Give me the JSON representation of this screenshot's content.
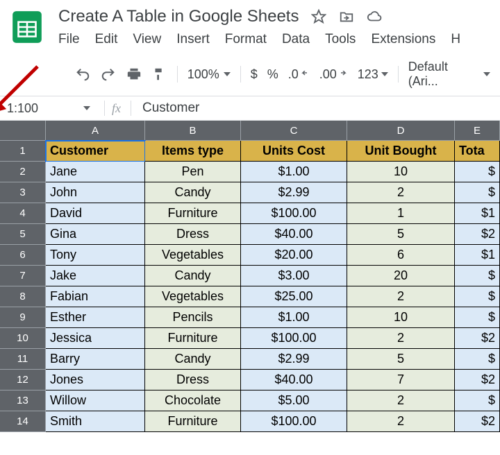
{
  "doc": {
    "title": "Create A Table in Google Sheets"
  },
  "menubar": [
    "File",
    "Edit",
    "View",
    "Insert",
    "Format",
    "Data",
    "Tools",
    "Extensions",
    "H"
  ],
  "toolbar": {
    "zoom": "100%",
    "currency": "$",
    "percent": "%",
    "dec_dec": ".0",
    "inc_dec": ".00",
    "more_fmt": "123",
    "font": "Default (Ari..."
  },
  "namebox": "1:100",
  "fx_label": "fx",
  "formula": "Customer",
  "columns": [
    "A",
    "B",
    "C",
    "D",
    "E"
  ],
  "rows": [
    "1",
    "2",
    "3",
    "4",
    "5",
    "6",
    "7",
    "8",
    "9",
    "10",
    "11",
    "12",
    "13",
    "14"
  ],
  "headers": {
    "A": "Customer",
    "B": "Items type",
    "C": "Units Cost",
    "D": "Unit Bought",
    "E": "Tota"
  },
  "data": [
    {
      "name": "Jane",
      "type": "Pen",
      "cost": "$1.00",
      "units": "10",
      "total": "$"
    },
    {
      "name": "John",
      "type": "Candy",
      "cost": "$2.99",
      "units": "2",
      "total": "$"
    },
    {
      "name": "David",
      "type": "Furniture",
      "cost": "$100.00",
      "units": "1",
      "total": "$1"
    },
    {
      "name": "Gina",
      "type": "Dress",
      "cost": "$40.00",
      "units": "5",
      "total": "$2"
    },
    {
      "name": "Tony",
      "type": "Vegetables",
      "cost": "$20.00",
      "units": "6",
      "total": "$1"
    },
    {
      "name": "Jake",
      "type": "Candy",
      "cost": "$3.00",
      "units": "20",
      "total": "$"
    },
    {
      "name": "Fabian",
      "type": "Vegetables",
      "cost": "$25.00",
      "units": "2",
      "total": "$"
    },
    {
      "name": "Esther",
      "type": "Pencils",
      "cost": "$1.00",
      "units": "10",
      "total": "$"
    },
    {
      "name": "Jessica",
      "type": "Furniture",
      "cost": "$100.00",
      "units": "2",
      "total": "$2"
    },
    {
      "name": "Barry",
      "type": "Candy",
      "cost": "$2.99",
      "units": "5",
      "total": "$"
    },
    {
      "name": "Jones",
      "type": "Dress",
      "cost": "$40.00",
      "units": "7",
      "total": "$2"
    },
    {
      "name": "Willow",
      "type": "Chocolate",
      "cost": "$5.00",
      "units": "2",
      "total": "$"
    },
    {
      "name": "Smith",
      "type": "Furniture",
      "cost": "$100.00",
      "units": "2",
      "total": "$2"
    }
  ]
}
